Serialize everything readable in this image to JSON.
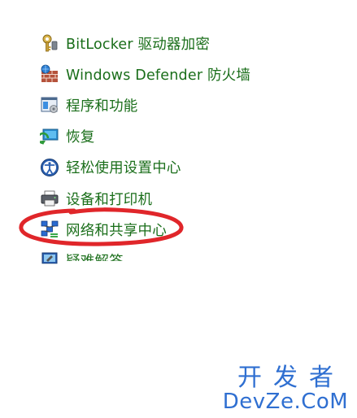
{
  "control_panel_items": [
    {
      "label": "BitLocker 驱动器加密",
      "icon": "bitlocker-keys-icon"
    },
    {
      "label": "Windows Defender 防火墙",
      "icon": "firewall-icon"
    },
    {
      "label": "程序和功能",
      "icon": "programs-features-icon"
    },
    {
      "label": "恢复",
      "icon": "recovery-icon"
    },
    {
      "label": "轻松使用设置中心",
      "icon": "ease-of-access-icon"
    },
    {
      "label": "设备和打印机",
      "icon": "devices-printers-icon"
    },
    {
      "label": "网络和共享中心",
      "icon": "network-sharing-icon"
    },
    {
      "label": "疑难解答",
      "icon": "troubleshooting-icon"
    }
  ],
  "watermark": {
    "line1": "开发者",
    "line2": "DevZe.CoM"
  },
  "colors": {
    "link_green": "#1a6e1a",
    "annotation_red": "#e0262a",
    "watermark_blue": "#2f6fd1"
  }
}
